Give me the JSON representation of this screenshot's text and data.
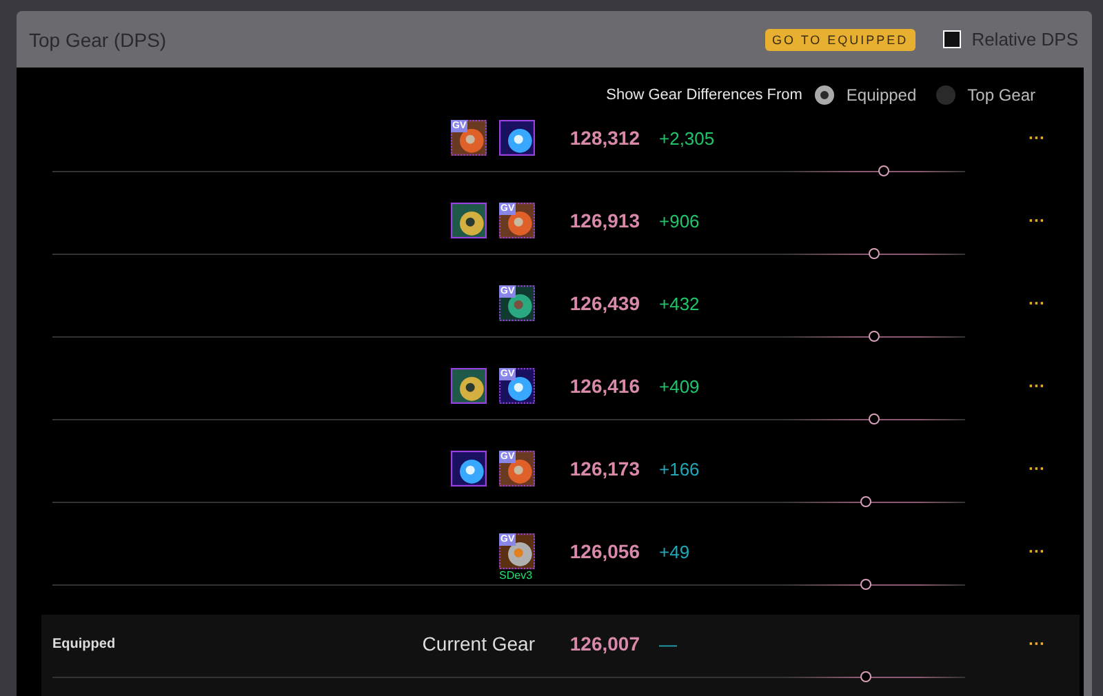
{
  "panel": {
    "title": "Top Gear (DPS)",
    "go_button": "GO TO EQUIPPED",
    "relative_dps": {
      "label": "Relative DPS",
      "checked": false
    }
  },
  "diff_from": {
    "label": "Show Gear Differences From",
    "options": [
      {
        "label": "Equipped",
        "selected": true
      },
      {
        "label": "Top Gear",
        "selected": false
      }
    ]
  },
  "rows": [
    {
      "items": [
        {
          "kind": "gear",
          "badge": "GV"
        },
        {
          "kind": "gem"
        }
      ],
      "dps": "128,312",
      "diff": "+2,305",
      "color": "#1fc46b",
      "level": 0.91,
      "menu": "···"
    },
    {
      "items": [
        {
          "kind": "chest"
        },
        {
          "kind": "gear",
          "badge": "GV"
        }
      ],
      "dps": "126,913",
      "diff": "+906",
      "color": "#1fc46b",
      "level": 0.9,
      "menu": "···"
    },
    {
      "items": [
        {
          "kind": "cloak",
          "badge": "GV"
        }
      ],
      "dps": "126,439",
      "diff": "+432",
      "color": "#1fc46b",
      "level": 0.9,
      "menu": "···"
    },
    {
      "items": [
        {
          "kind": "chest"
        },
        {
          "kind": "gem",
          "badge": "GV"
        }
      ],
      "dps": "126,416",
      "diff": "+409",
      "color": "#1fc46b",
      "level": 0.9,
      "menu": "···"
    },
    {
      "items": [
        {
          "kind": "gem"
        },
        {
          "kind": "gear",
          "badge": "GV"
        }
      ],
      "dps": "126,173",
      "diff": "+166",
      "color": "#1fa8b8",
      "level": 0.89,
      "menu": "···"
    },
    {
      "items": [
        {
          "kind": "bracer",
          "badge": "GV",
          "tag": "SDev3"
        }
      ],
      "dps": "126,056",
      "diff": "+49",
      "color": "#1fa8b8",
      "level": 0.89,
      "menu": "···"
    }
  ],
  "equipped": {
    "label": "Equipped",
    "name": "Current Gear",
    "dps": "126,007",
    "diff": "—",
    "color": "#1fa8b8",
    "level": 0.89,
    "menu": "···"
  }
}
